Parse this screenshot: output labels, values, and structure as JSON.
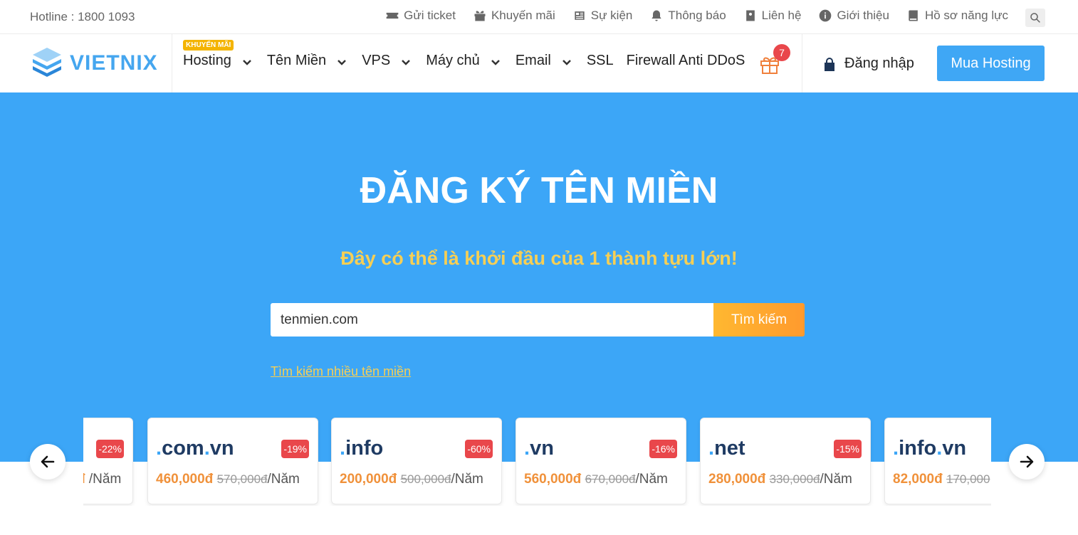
{
  "topbar": {
    "hotline": "Hotline : 1800 1093",
    "links": [
      {
        "label": "Gửi ticket",
        "icon": "ticket-icon"
      },
      {
        "label": "Khuyến mãi",
        "icon": "gift-icon"
      },
      {
        "label": "Sự kiện",
        "icon": "newspaper-icon"
      },
      {
        "label": "Thông báo",
        "icon": "bell-icon"
      },
      {
        "label": "Liên hệ",
        "icon": "contact-icon"
      },
      {
        "label": "Giới thiệu",
        "icon": "info-icon"
      },
      {
        "label": "Hồ sơ năng lực",
        "icon": "book-icon"
      }
    ],
    "search_icon": "search-icon"
  },
  "nav": {
    "logo_text": "VIETNIX",
    "promo_badge": "KHUYẾN MÃI",
    "items": [
      {
        "label": "Hosting",
        "has_dropdown": true
      },
      {
        "label": "Tên Miền",
        "has_dropdown": true
      },
      {
        "label": "VPS",
        "has_dropdown": true
      },
      {
        "label": "Máy chủ",
        "has_dropdown": true
      },
      {
        "label": "Email",
        "has_dropdown": true
      },
      {
        "label": "SSL",
        "has_dropdown": false
      },
      {
        "label": "Firewall Anti DDoS",
        "has_dropdown": false
      }
    ],
    "gift_count": "7",
    "login_label": "Đăng nhập",
    "buy_label": "Mua Hosting"
  },
  "hero": {
    "title": "ĐĂNG KÝ TÊN MIỀN",
    "subtitle": "Đây có thể là khởi đầu của 1 thành tựu lớn!",
    "search_value": "tenmien.com",
    "search_button": "Tìm kiếm",
    "multi_search_link": "Tìm kiếm nhiều tên miền"
  },
  "domains": [
    {
      "ext_parts": [],
      "discount": "-22%",
      "price": "",
      "old_price": "",
      "per": "/Năm",
      "partial_prefix": "đ"
    },
    {
      "ext_parts": [
        ".",
        "com",
        ".",
        "vn"
      ],
      "discount": "-19%",
      "price": "460,000đ",
      "old_price": "570,000đ",
      "per": "/Năm"
    },
    {
      "ext_parts": [
        ".",
        "info"
      ],
      "discount": "-60%",
      "price": "200,000đ",
      "old_price": "500,000đ",
      "per": "/Năm"
    },
    {
      "ext_parts": [
        ".",
        "vn"
      ],
      "discount": "-16%",
      "price": "560,000đ",
      "old_price": "670,000đ",
      "per": "/Năm"
    },
    {
      "ext_parts": [
        ".",
        "net"
      ],
      "discount": "-15%",
      "price": "280,000đ",
      "old_price": "330,000đ",
      "per": "/Năm"
    },
    {
      "ext_parts": [
        ".",
        "info",
        ".",
        "vn"
      ],
      "discount": "",
      "price": "82,000đ",
      "old_price": "170,000",
      "per": ""
    }
  ],
  "colors": {
    "hero_bg": "#3ca6f7",
    "accent_blue": "#3fa7f5",
    "subtitle_yellow": "#f6cf55",
    "price_orange": "#f0913a",
    "discount_red": "#e9474b",
    "domain_navy": "#1f3b63"
  }
}
